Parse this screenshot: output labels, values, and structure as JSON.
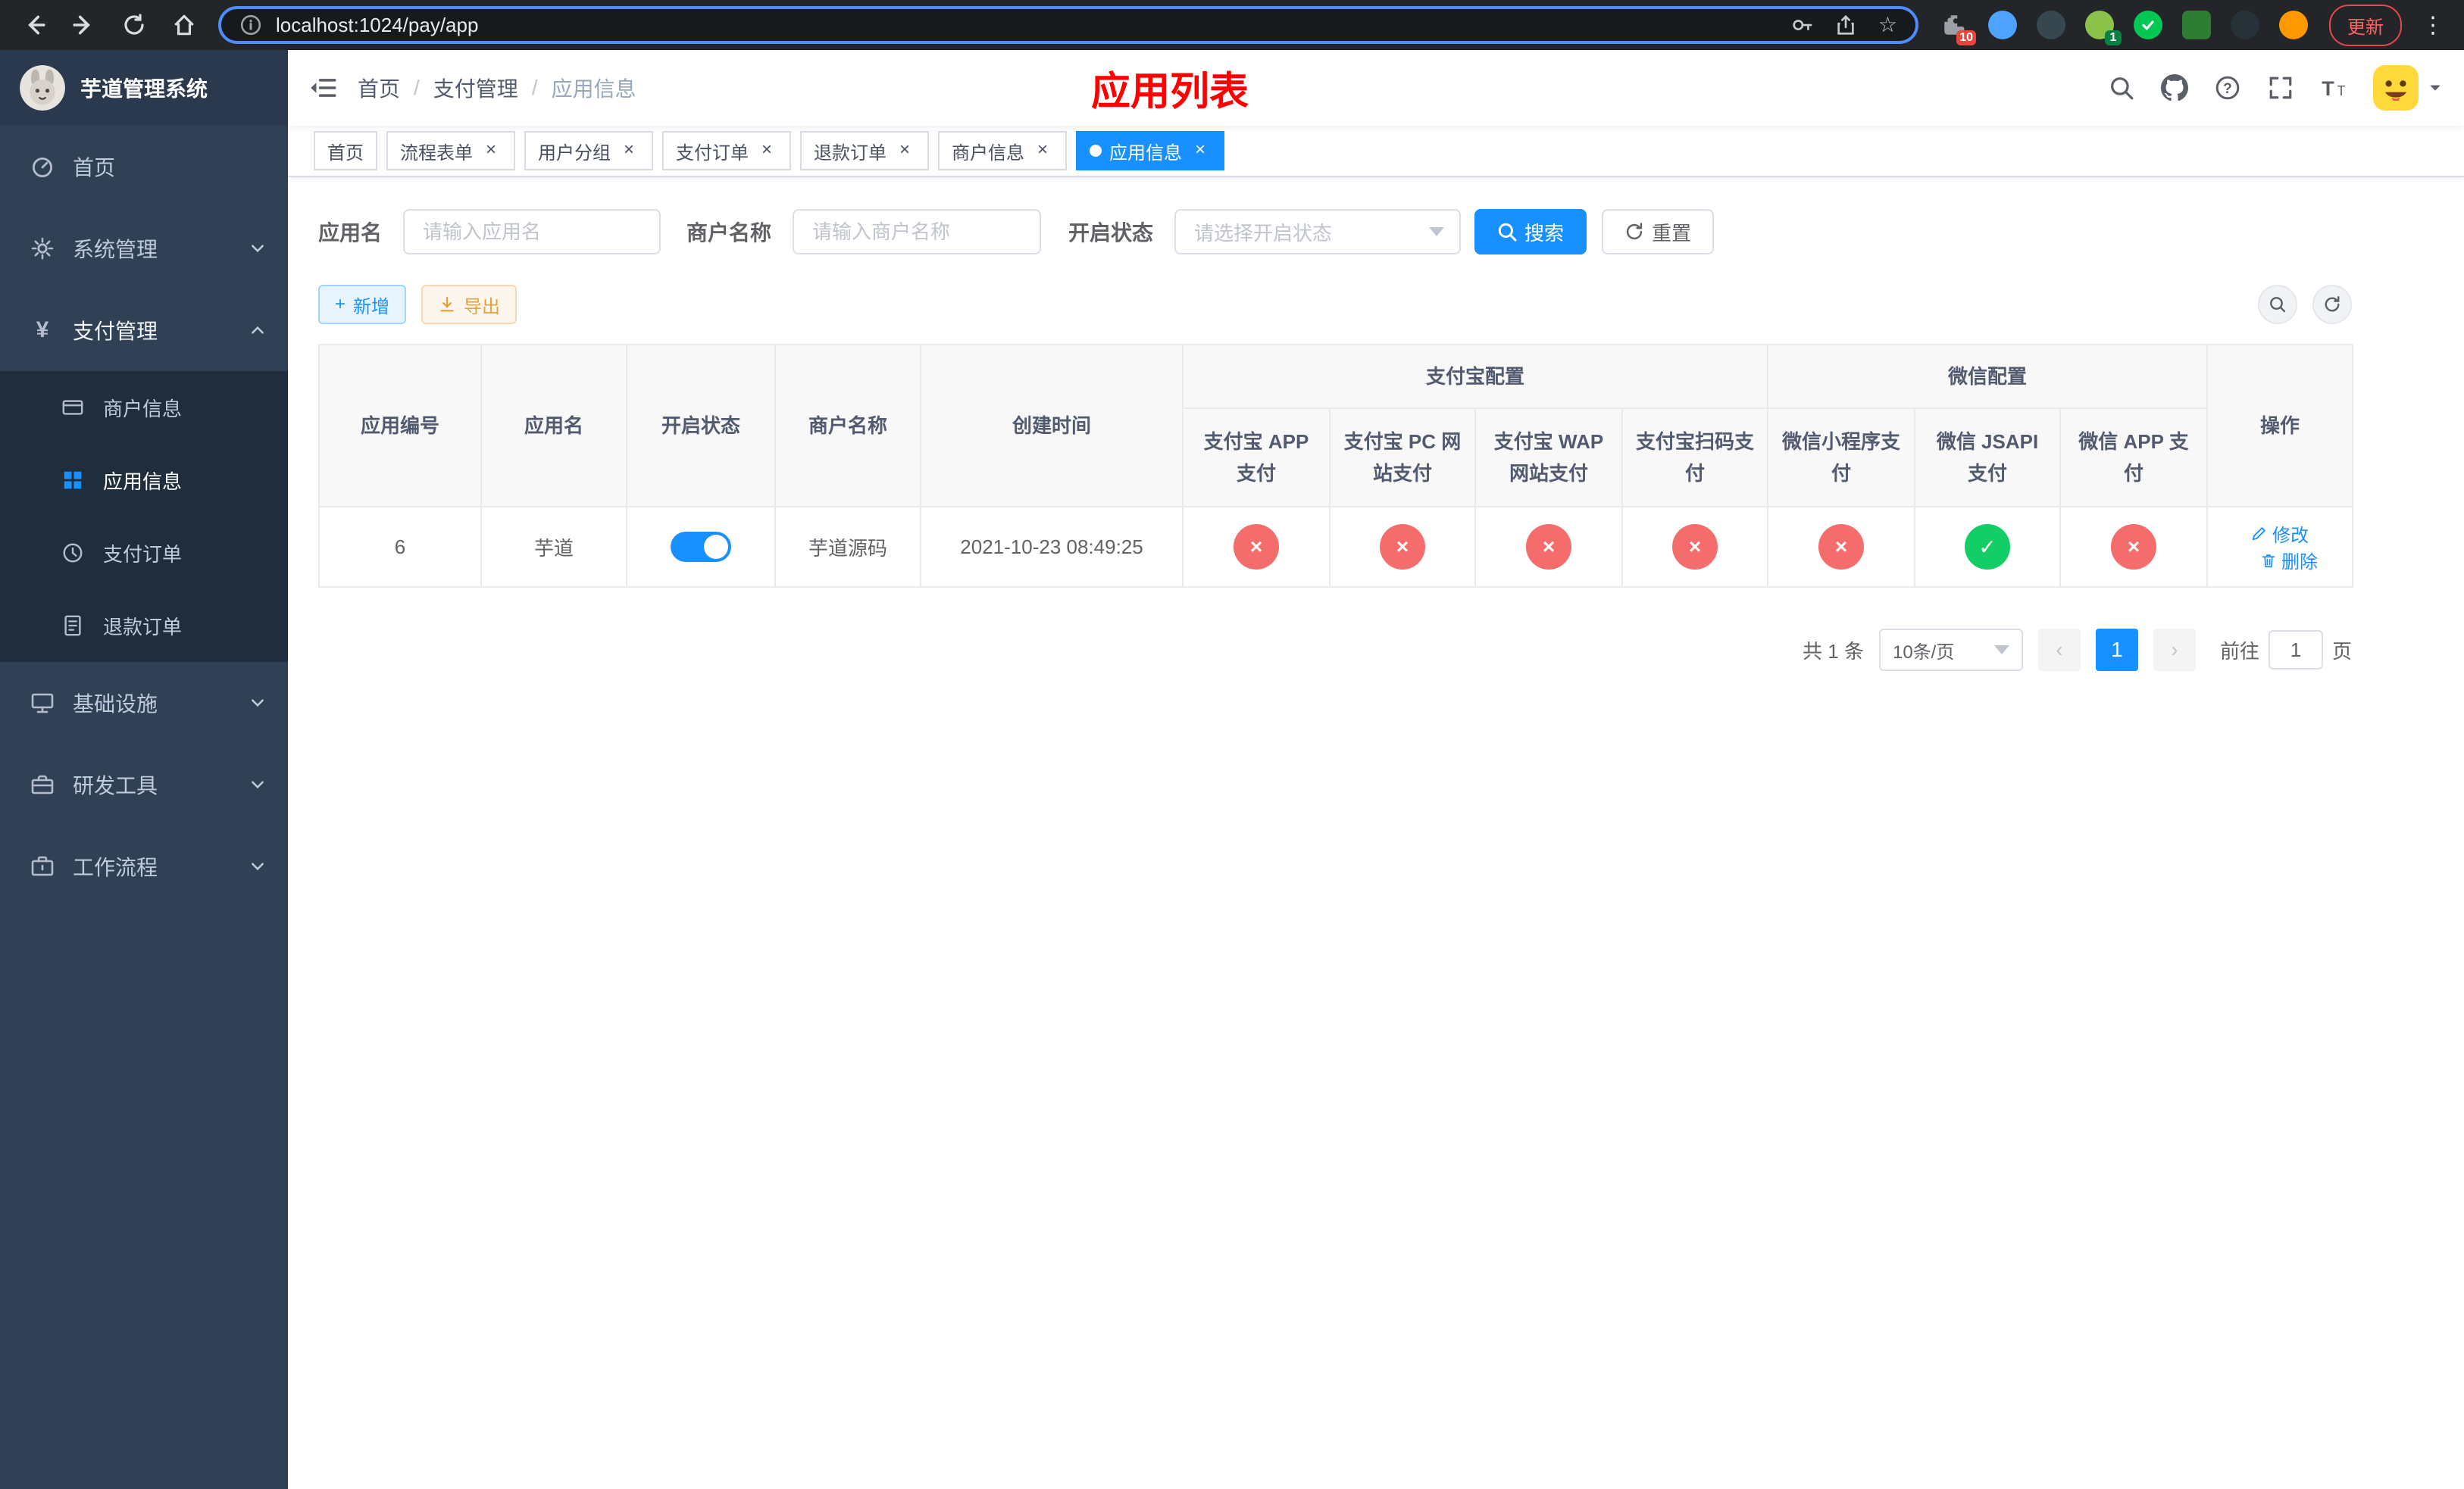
{
  "browser": {
    "url": "localhost:1024/pay/app",
    "update_label": "更新",
    "extension_badge": "10",
    "profile_badge": "1"
  },
  "icons": {
    "close": "×",
    "check": "✓",
    "cross": "×",
    "kebab": "⋮",
    "yen": "¥",
    "star": "☆",
    "question": "?",
    "plus": "+",
    "prev": "‹",
    "next": "›",
    "font_large": "T",
    "font_small": "T"
  },
  "sidebar": {
    "title": "芋道管理系统",
    "menu": [
      {
        "label": "首页"
      },
      {
        "label": "系统管理"
      },
      {
        "label": "支付管理"
      },
      {
        "label": "商户信息"
      },
      {
        "label": "应用信息"
      },
      {
        "label": "支付订单"
      },
      {
        "label": "退款订单"
      },
      {
        "label": "基础设施"
      },
      {
        "label": "研发工具"
      },
      {
        "label": "工作流程"
      }
    ]
  },
  "header": {
    "breadcrumb": [
      "首页",
      "支付管理",
      "应用信息"
    ],
    "page_title": "应用列表"
  },
  "tabs": [
    {
      "label": "首页",
      "closable": false,
      "active": false
    },
    {
      "label": "流程表单",
      "closable": true,
      "active": false
    },
    {
      "label": "用户分组",
      "closable": true,
      "active": false
    },
    {
      "label": "支付订单",
      "closable": true,
      "active": false
    },
    {
      "label": "退款订单",
      "closable": true,
      "active": false
    },
    {
      "label": "商户信息",
      "closable": true,
      "active": false
    },
    {
      "label": "应用信息",
      "closable": true,
      "active": true
    }
  ],
  "filters": {
    "app_name_label": "应用名",
    "app_name_placeholder": "请输入应用名",
    "merchant_label": "商户名称",
    "merchant_placeholder": "请输入商户名称",
    "status_label": "开启状态",
    "status_placeholder": "请选择开启状态",
    "search_label": "搜索",
    "reset_label": "重置"
  },
  "toolbar": {
    "add_label": "新增",
    "export_label": "导出"
  },
  "table": {
    "groups": {
      "alipay": "支付宝配置",
      "wechat": "微信配置"
    },
    "columns": {
      "id": "应用编号",
      "name": "应用名",
      "status": "开启状态",
      "merchant": "商户名称",
      "created": "创建时间",
      "alipay_app": "支付宝 APP 支付",
      "alipay_pc": "支付宝 PC 网站支付",
      "alipay_wap": "支付宝 WAP 网站支付",
      "alipay_qr": "支付宝扫码支付",
      "wx_mini": "微信小程序支付",
      "wx_jsapi": "微信 JSAPI 支付",
      "wx_app": "微信 APP 支付",
      "actions": "操作"
    },
    "row": {
      "id": "6",
      "name": "芋道",
      "status_on": true,
      "merchant": "芋道源码",
      "created": "2021-10-23 08:49:25",
      "configs": [
        false,
        false,
        false,
        false,
        false,
        true,
        false
      ],
      "edit_label": "修改",
      "delete_label": "删除"
    }
  },
  "pagination": {
    "total_text": "共 1 条",
    "page_size": "10条/页",
    "page": "1",
    "goto_label": "前往",
    "goto_value": "1",
    "page_unit": "页"
  },
  "colors": {
    "accent": "#1890ff",
    "danger": "#f56c6c",
    "success": "#13ce66",
    "warning": "#e6a23c",
    "title_red": "#ff0000",
    "sidebar_bg": "#304156",
    "submenu_bg": "#1f2d3d"
  }
}
